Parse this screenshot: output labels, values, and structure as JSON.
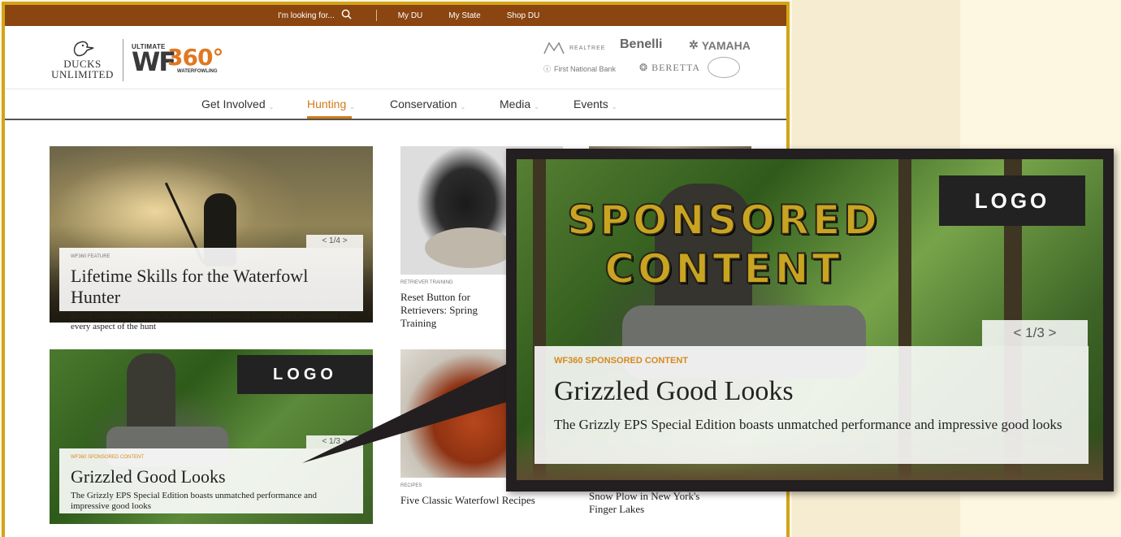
{
  "topbar": {
    "search_label": "I'm looking for...",
    "links": [
      "My DU",
      "My State",
      "Shop DU"
    ],
    "background": "#8a4510"
  },
  "header": {
    "du_logo_line1": "DUCKS",
    "du_logo_line2": "UNLIMITED",
    "wf_ultimate": "ULTIMATE",
    "wf_main": "WF",
    "wf_360": "360°",
    "wf_waterfowling": "WATERFOWLING",
    "sponsors": [
      "REALTREE",
      "Benelli",
      "YAMAHA",
      "First National Bank",
      "BERETTA"
    ]
  },
  "nav": {
    "items": [
      "Get Involved",
      "Hunting",
      "Conservation",
      "Media",
      "Events"
    ],
    "active": "Hunting",
    "accent": "#d07c18"
  },
  "cards": {
    "feature": {
      "tag": "WF360 FEATURE",
      "title": "Lifetime Skills for the Waterfowl Hunter",
      "desc": "Better waterfowl hunting is an ongoing process of learning and developing in every aspect of the hunt",
      "pager": "< 1/4 >"
    },
    "retriever": {
      "tag": "RETRIEVER TRAINING",
      "title": "Reset Button for Retrievers: Spring Training"
    },
    "sponsored": {
      "tag": "WF360 SPONSORED CONTENT",
      "title": "Grizzled Good Looks",
      "desc": "The Grizzly EPS Special Edition boasts unmatched performance and impressive good looks",
      "pager": "< 1/3 >",
      "logo": "LOGO"
    },
    "recipes": {
      "tag": "RECIPES",
      "title": "Five Classic Waterfowl Recipes"
    },
    "snow": {
      "title_line1": "Snow Plow in New York's",
      "title_line2": "Finger Lakes"
    }
  },
  "zoom": {
    "logo": "LOGO",
    "sponsored_line1": "SPONSORED",
    "sponsored_line2": "CONTENT",
    "pager": "< 1/3 >",
    "tag": "WF360 SPONSORED CONTENT",
    "title": "Grizzled Good Looks",
    "desc": "The Grizzly EPS Special Edition boasts unmatched performance and impressive good looks",
    "sponsored_color": "#c9a421"
  }
}
